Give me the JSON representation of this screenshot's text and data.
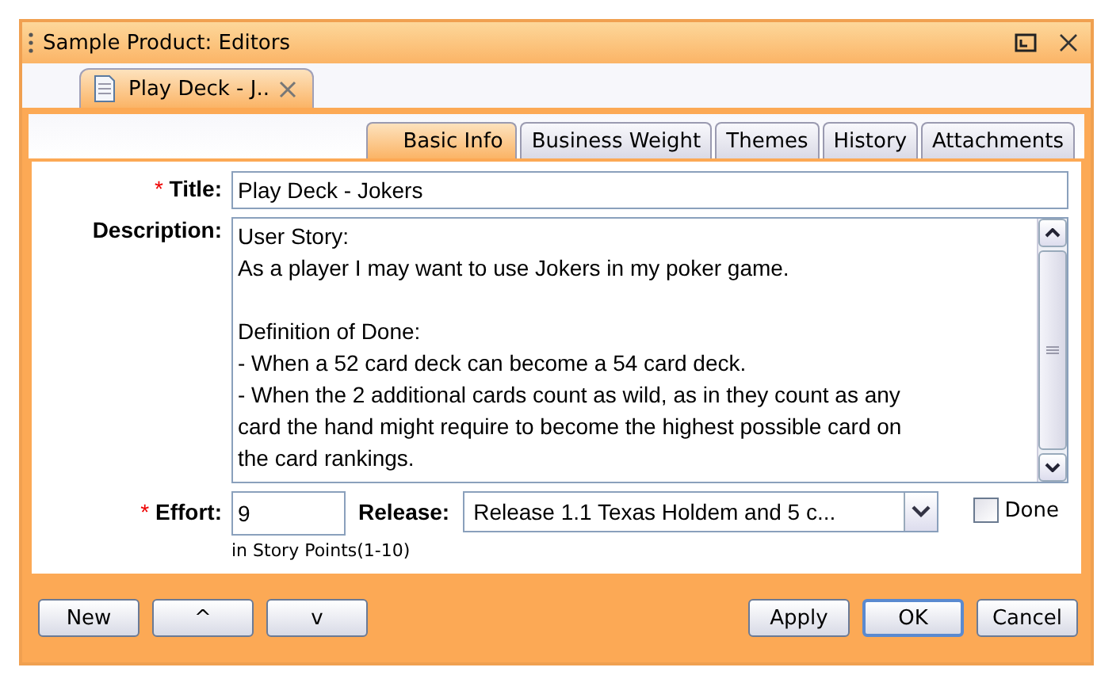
{
  "window": {
    "title": "Sample Product: Editors"
  },
  "document_tabs": [
    {
      "label": "Play Deck - J..",
      "selected": true
    }
  ],
  "tabs": [
    {
      "label": "Basic Info",
      "selected": true
    },
    {
      "label": "Business Weight",
      "selected": false
    },
    {
      "label": "Themes",
      "selected": false
    },
    {
      "label": "History",
      "selected": false
    },
    {
      "label": "Attachments",
      "selected": false
    }
  ],
  "form": {
    "title": {
      "label": "Title:",
      "required_mark": "*",
      "value": "Play Deck - Jokers"
    },
    "description": {
      "label": "Description:",
      "paragraphs": [
        [
          "User Story:",
          "As a player I may want to use Jokers in my poker game."
        ],
        [
          "Definition of Done:",
          "- When a 52 card deck can become a 54 card deck.",
          "- When the 2 additional cards count as wild, as in they count as any",
          "card the hand might require to become the highest possible card on",
          "the card rankings."
        ]
      ]
    },
    "effort": {
      "label": "Effort:",
      "required_mark": "*",
      "value": "9",
      "hint": "in Story Points(1-10)"
    },
    "release": {
      "label": "Release:",
      "value": "Release 1.1 Texas Holdem and 5 c..."
    },
    "done": {
      "label": "Done",
      "checked": false
    }
  },
  "buttons_left": [
    "New",
    "^",
    "v"
  ],
  "buttons_right": [
    {
      "label": "Apply",
      "selected": false
    },
    {
      "label": "OK",
      "selected": true
    },
    {
      "label": "Cancel",
      "selected": false
    }
  ]
}
